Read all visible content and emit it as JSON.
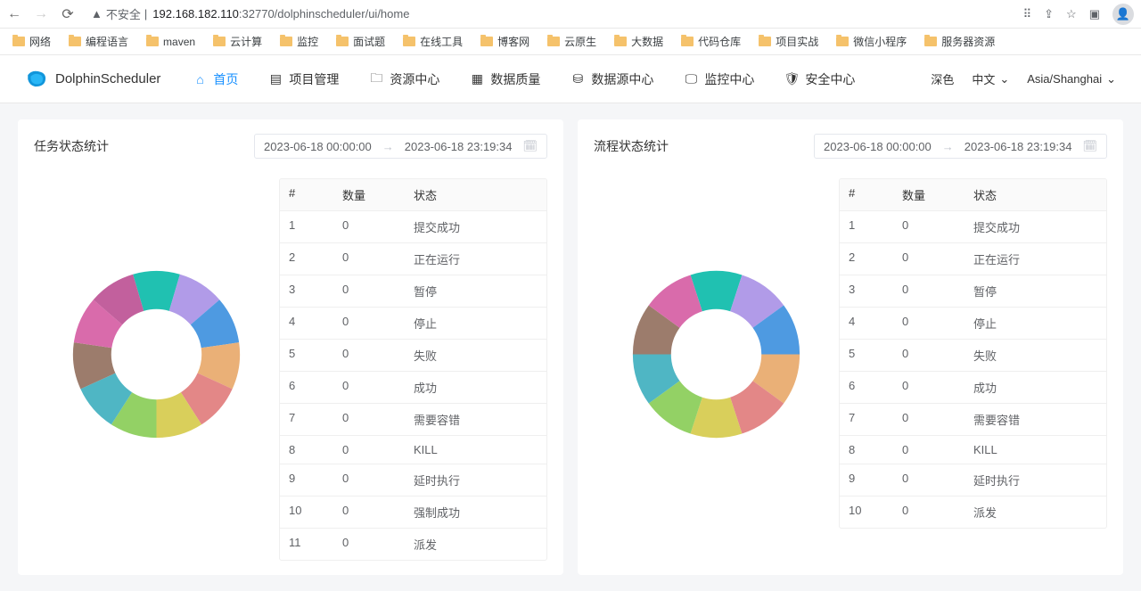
{
  "browser": {
    "security_label": "不安全",
    "url_host": "192.168.182.110",
    "url_port_path": ":32770/dolphinscheduler/ui/home"
  },
  "bookmarks": [
    "网络",
    "编程语言",
    "maven",
    "云计算",
    "监控",
    "面试题",
    "在线工具",
    "博客网",
    "云原生",
    "大数据",
    "代码仓库",
    "项目实战",
    "微信小程序",
    "服务器资源"
  ],
  "app": {
    "name": "DolphinScheduler",
    "nav": [
      {
        "label": "首页",
        "active": true
      },
      {
        "label": "项目管理"
      },
      {
        "label": "资源中心"
      },
      {
        "label": "数据质量"
      },
      {
        "label": "数据源中心"
      },
      {
        "label": "监控中心"
      },
      {
        "label": "安全中心"
      }
    ],
    "theme": "深色",
    "lang": "中文",
    "tz": "Asia/Shanghai"
  },
  "panels": [
    {
      "title": "任务状态统计",
      "from": "2023-06-18 00:00:00",
      "to": "2023-06-18 23:19:34",
      "cols": [
        "#",
        "数量",
        "状态"
      ],
      "rows": [
        [
          "1",
          "0",
          "提交成功"
        ],
        [
          "2",
          "0",
          "正在运行"
        ],
        [
          "3",
          "0",
          "暂停"
        ],
        [
          "4",
          "0",
          "停止"
        ],
        [
          "5",
          "0",
          "失败"
        ],
        [
          "6",
          "0",
          "成功"
        ],
        [
          "7",
          "0",
          "需要容错"
        ],
        [
          "8",
          "0",
          "KILL"
        ],
        [
          "9",
          "0",
          "延时执行"
        ],
        [
          "10",
          "0",
          "强制成功"
        ],
        [
          "11",
          "0",
          "派发"
        ]
      ]
    },
    {
      "title": "流程状态统计",
      "from": "2023-06-18 00:00:00",
      "to": "2023-06-18 23:19:34",
      "cols": [
        "#",
        "数量",
        "状态"
      ],
      "rows": [
        [
          "1",
          "0",
          "提交成功"
        ],
        [
          "2",
          "0",
          "正在运行"
        ],
        [
          "3",
          "0",
          "暂停"
        ],
        [
          "4",
          "0",
          "停止"
        ],
        [
          "5",
          "0",
          "失败"
        ],
        [
          "6",
          "0",
          "成功"
        ],
        [
          "7",
          "0",
          "需要容错"
        ],
        [
          "8",
          "0",
          "KILL"
        ],
        [
          "9",
          "0",
          "延时执行"
        ],
        [
          "10",
          "0",
          "派发"
        ]
      ]
    }
  ],
  "donut_colors": [
    "#20c1b1",
    "#b19be8",
    "#4e9ae1",
    "#eab077",
    "#e38787",
    "#d9cf5b",
    "#93d165",
    "#4fb6c4",
    "#9c7c6c",
    "#d96bab",
    "#c2609d"
  ],
  "chart_data": [
    {
      "type": "pie",
      "title": "任务状态统计",
      "categories": [
        "提交成功",
        "正在运行",
        "暂停",
        "停止",
        "失败",
        "成功",
        "需要容错",
        "KILL",
        "延时执行",
        "强制成功",
        "派发"
      ],
      "values": [
        0,
        0,
        0,
        0,
        0,
        0,
        0,
        0,
        0,
        0,
        0
      ],
      "note": "All values are zero; donut slices are rendered with equal angular width as a placeholder, matching the screenshot."
    },
    {
      "type": "pie",
      "title": "流程状态统计",
      "categories": [
        "提交成功",
        "正在运行",
        "暂停",
        "停止",
        "失败",
        "成功",
        "需要容错",
        "KILL",
        "延时执行",
        "派发"
      ],
      "values": [
        0,
        0,
        0,
        0,
        0,
        0,
        0,
        0,
        0,
        0
      ],
      "note": "All values are zero; donut slices are rendered with equal angular width as a placeholder, matching the screenshot."
    }
  ]
}
